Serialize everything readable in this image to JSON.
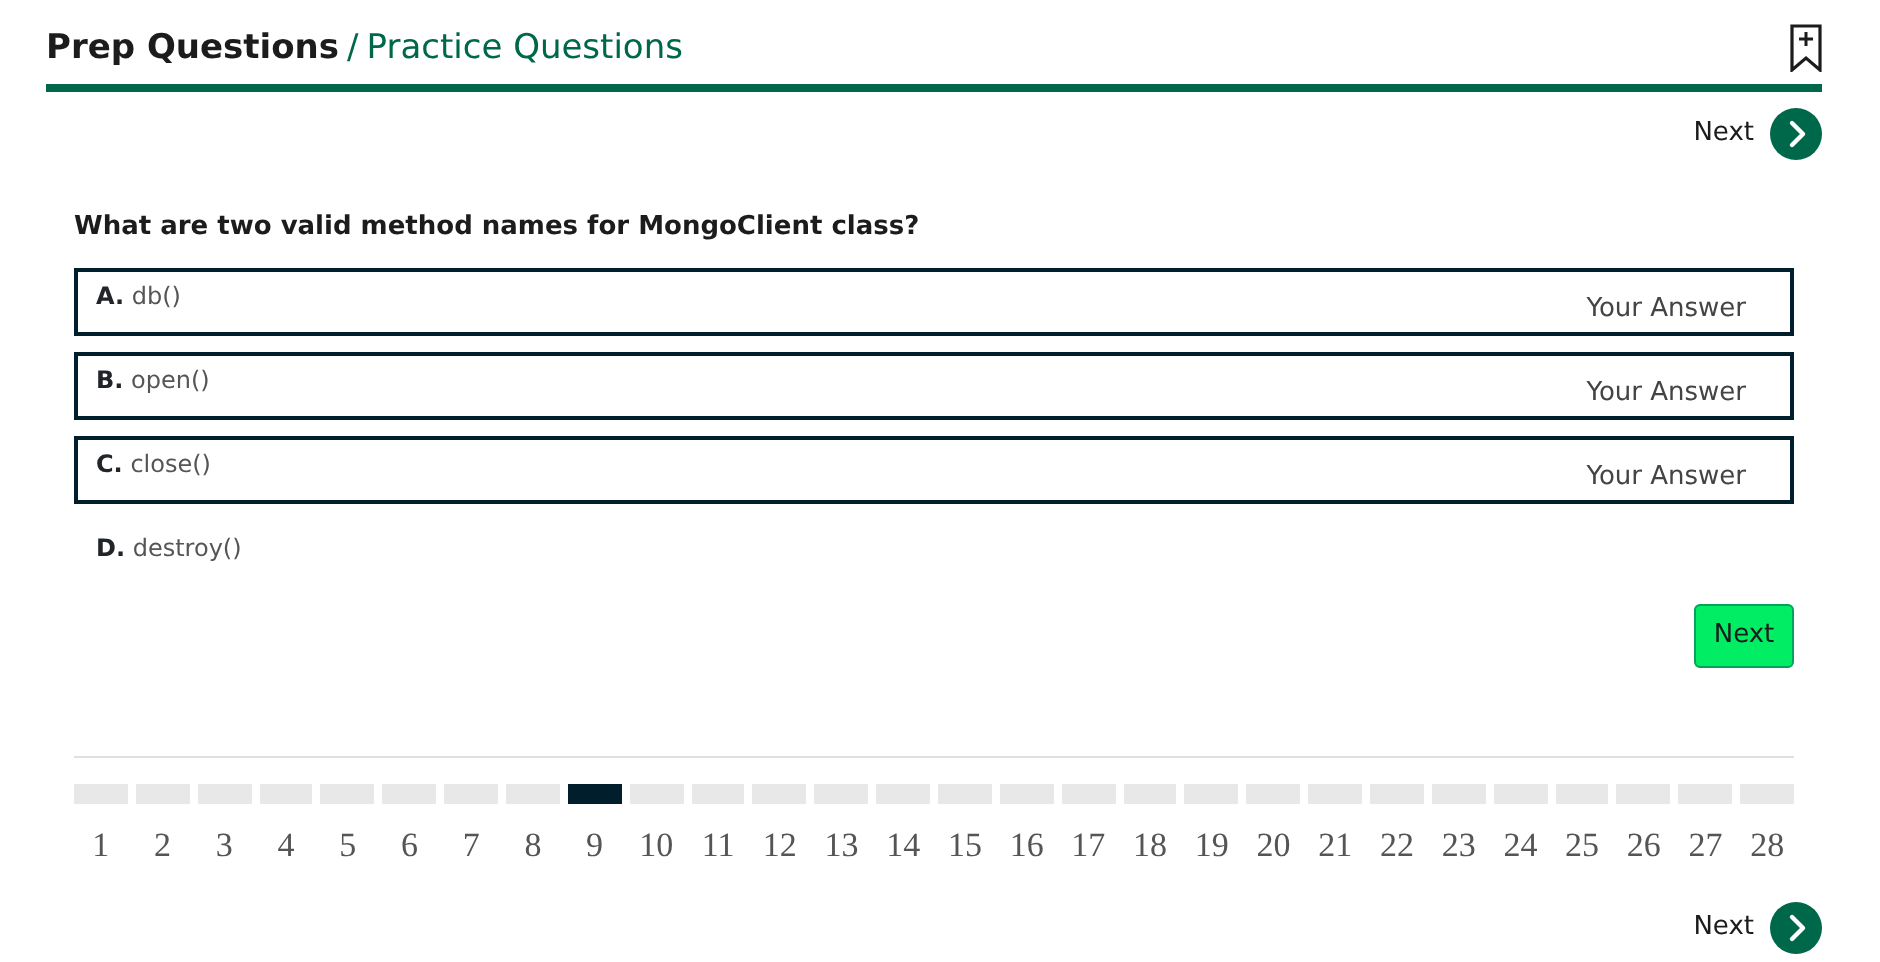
{
  "breadcrumb": {
    "parent": "Prep Questions",
    "separator": "/",
    "current": "Practice Questions"
  },
  "top_nav": {
    "label": "Next"
  },
  "question": "What are two valid method names for MongoClient class?",
  "options": [
    {
      "letter": "A.",
      "text": "db()",
      "selected": true,
      "answer_label": "Your Answer"
    },
    {
      "letter": "B.",
      "text": "open()",
      "selected": true,
      "answer_label": "Your Answer"
    },
    {
      "letter": "C.",
      "text": "close()",
      "selected": true,
      "answer_label": "Your Answer"
    },
    {
      "letter": "D.",
      "text": "destroy()",
      "selected": false
    }
  ],
  "submit_button": "Next",
  "progress": [
    {
      "label": "1",
      "selected": false
    },
    {
      "label": "2",
      "selected": false
    },
    {
      "label": "3",
      "selected": false
    },
    {
      "label": "4",
      "selected": false
    },
    {
      "label": "5",
      "selected": false
    },
    {
      "label": "6",
      "selected": false
    },
    {
      "label": "7",
      "selected": false
    },
    {
      "label": "8",
      "selected": false
    },
    {
      "label": "9",
      "selected": true
    },
    {
      "label": "10",
      "selected": false
    },
    {
      "label": "11",
      "selected": false
    },
    {
      "label": "12",
      "selected": false
    },
    {
      "label": "13",
      "selected": false
    },
    {
      "label": "14",
      "selected": false
    },
    {
      "label": "15",
      "selected": false
    },
    {
      "label": "16",
      "selected": false
    },
    {
      "label": "17",
      "selected": false
    },
    {
      "label": "18",
      "selected": false
    },
    {
      "label": "19",
      "selected": false
    },
    {
      "label": "20",
      "selected": false
    },
    {
      "label": "21",
      "selected": false
    },
    {
      "label": "22",
      "selected": false
    },
    {
      "label": "23",
      "selected": false
    },
    {
      "label": "24",
      "selected": false
    },
    {
      "label": "25",
      "selected": false
    },
    {
      "label": "26",
      "selected": false
    },
    {
      "label": "27",
      "selected": false
    },
    {
      "label": "28",
      "selected": false
    }
  ],
  "bottom_nav": {
    "label": "Next"
  }
}
